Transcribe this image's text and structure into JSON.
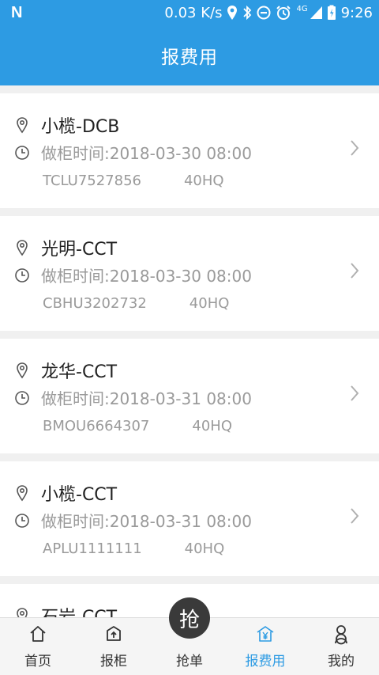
{
  "status_bar": {
    "network_speed": "0.03 K/s",
    "signal_label": "4G",
    "time": "9:26"
  },
  "header": {
    "title": "报费用"
  },
  "orders": [
    {
      "place": "小榄-DCB",
      "time": "做柜时间:2018-03-30 08:00",
      "container_no": "TCLU7527856",
      "container_type": "40HQ"
    },
    {
      "place": "光明-CCT",
      "time": "做柜时间:2018-03-30 08:00",
      "container_no": "CBHU3202732",
      "container_type": "40HQ"
    },
    {
      "place": "龙华-CCT",
      "time": "做柜时间:2018-03-31 08:00",
      "container_no": "BMOU6664307",
      "container_type": "40HQ"
    },
    {
      "place": "小榄-CCT",
      "time": "做柜时间:2018-03-31 08:00",
      "container_no": "APLU1111111",
      "container_type": "40HQ"
    },
    {
      "place": "石岩-CCT"
    }
  ],
  "tabbar": {
    "tabs": [
      {
        "label": "首页",
        "icon": "home-icon"
      },
      {
        "label": "报柜",
        "icon": "upload-box-icon"
      },
      {
        "label": "抢单",
        "icon": "grab-circle"
      },
      {
        "label": "报费用",
        "icon": "yen-house-icon",
        "active": true
      },
      {
        "label": "我的",
        "icon": "person-icon"
      }
    ],
    "grab_button_text": "抢"
  },
  "colors": {
    "primary": "#2d9be3",
    "text": "#222222",
    "muted": "#9a9a9a"
  }
}
